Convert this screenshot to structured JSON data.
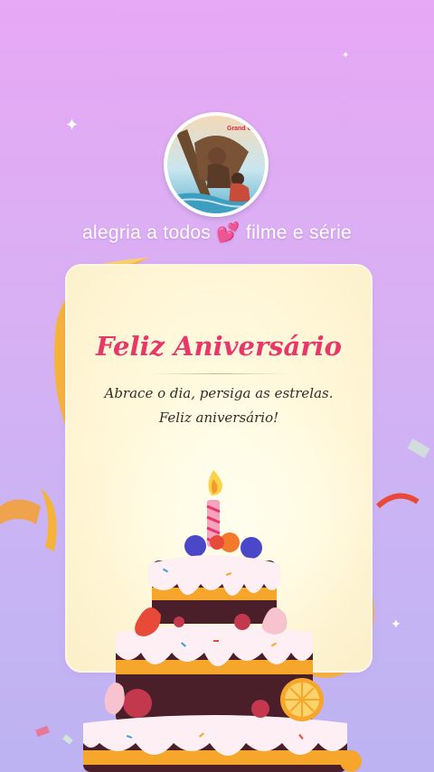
{
  "profile": {
    "page_name": "alegria a todos 💕 filme e série",
    "avatar_caption": "Grand Gir"
  },
  "card": {
    "title": "Feliz Aniversário",
    "message": "Abrace o dia, persiga as estrelas. Feliz aniversário!"
  },
  "colors": {
    "background_top": "#e7a8f5",
    "background_bottom": "#bdb3f2",
    "title": "#e8386a",
    "card": "#fff6d6",
    "ribbon": "#f6b33a"
  }
}
